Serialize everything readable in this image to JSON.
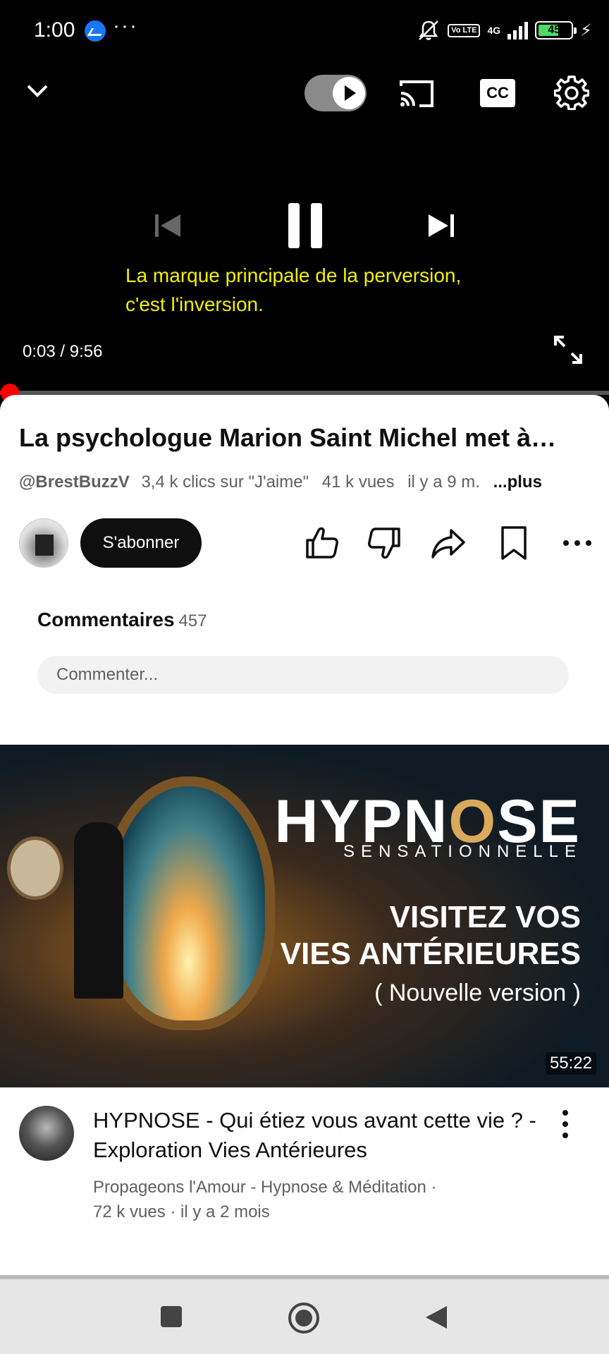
{
  "status_bar": {
    "time": "1:00",
    "dots": "···",
    "volte": "Vo LTE",
    "network": "4G",
    "battery": "45",
    "bolt": "⚡"
  },
  "player": {
    "subtitle_line1": "La marque principale de la perversion,",
    "subtitle_line2": "c'est l'inversion.",
    "time": "0:03 / 9:56",
    "cc_label": "CC",
    "progress_fraction": 0.005
  },
  "video": {
    "title": "La psychologue Marion Saint Michel met à…",
    "channel": "@BrestBuzzV",
    "likes": "3,4 k clics sur \"J'aime\"",
    "views": "41 k vues",
    "age": "il y a 9 m.",
    "more": "...plus",
    "subscribe": "S'abonner"
  },
  "comments": {
    "label": "Commentaires",
    "count": "457",
    "placeholder": "Commenter..."
  },
  "recommended": {
    "thumb_brand_pre": "HYPN",
    "thumb_brand_o": "O",
    "thumb_brand_post": "SE",
    "thumb_sub": "SENSATIONNELLE",
    "thumb_line1": "VISITEZ VOS",
    "thumb_line2": "VIES ANTÉRIEURES",
    "thumb_line3": "( Nouvelle version )",
    "duration": "55:22",
    "title": "HYPNOSE - Qui étiez vous avant cette vie ? - Exploration Vies Antérieures",
    "channel_line": "Propageons l'Amour - Hypnose & Méditation ·",
    "stats_line": "72 k vues · il y a 2 mois"
  },
  "icons": [
    "messenger-icon",
    "mute-icon",
    "chevron-down-icon",
    "autoplay-toggle",
    "cast-icon",
    "cc-icon",
    "settings-icon",
    "previous-icon",
    "pause-icon",
    "next-icon",
    "fullscreen-icon",
    "like-icon",
    "dislike-icon",
    "share-icon",
    "save-icon",
    "more-icon",
    "recents-icon",
    "home-icon",
    "back-icon"
  ],
  "colors": {
    "subtitle": "#f1f100",
    "progress": "#ff0000",
    "accent_gold": "#d9a95c"
  }
}
